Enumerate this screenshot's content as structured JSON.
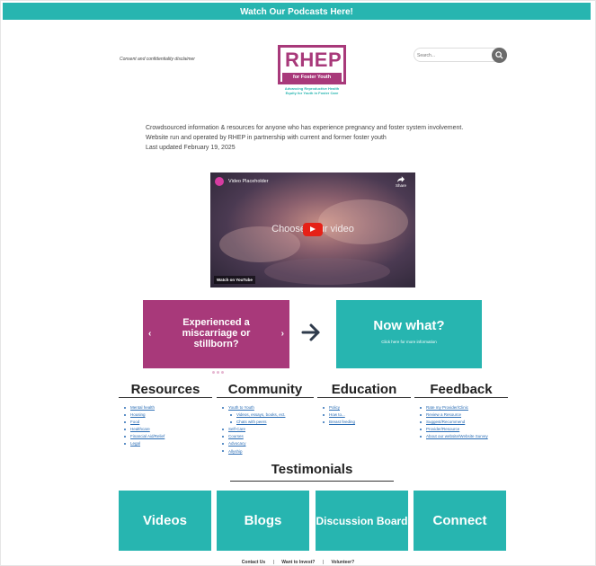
{
  "top_banner": {
    "label": "Watch Our Podcasts Here!",
    "color": "#27b5b0"
  },
  "header": {
    "disclaimer": "Consent and confidentiality disclaimer",
    "logo": {
      "word": "RHEP",
      "subtitle": "for Foster Youth",
      "tagline_1": "Advancing Reproductive Health",
      "tagline_2": "Equity for Youth in Foster Care",
      "color": "#a8397a"
    },
    "search": {
      "placeholder": "Search..."
    }
  },
  "intro": {
    "line_1": "Crowdsourced information & resources for anyone who has experience pregnancy and foster system involvement.",
    "line_2": "Website run and operated by RHEP in partnership with current and former foster youth",
    "line_3": "Last updated February 19, 2025"
  },
  "video": {
    "title": "Video Placeholder",
    "center_text": "Choose your video",
    "share_label": "Share",
    "watch_on": "Watch on",
    "youtube_label": "YouTube"
  },
  "carousel": {
    "slide_text": "Experienced a miscarriage or stillborn?",
    "color": "#a8397a",
    "slide_count": 4,
    "active_index": 0
  },
  "now_what": {
    "title": "Now what?",
    "subtitle": "Click here for more information",
    "color": "#27b5b0"
  },
  "sections": {
    "resources": {
      "title": "Resources",
      "items": [
        "Mental health",
        "Housing",
        "Food",
        "Healthcare",
        "Financial Aid/Relief",
        "Legal"
      ]
    },
    "community": {
      "title": "Community",
      "items": [
        {
          "label": "Youth to Youth",
          "sub": false
        },
        {
          "label": "Videos, essays, books, ect.",
          "sub": true
        },
        {
          "label": "Chats with peers",
          "sub": true
        },
        {
          "label": "Self-Care",
          "sub": false
        },
        {
          "label": "Courses",
          "sub": false
        },
        {
          "label": "Advocacy",
          "sub": false
        },
        {
          "label": "Allyship",
          "sub": false
        }
      ]
    },
    "education": {
      "title": "Education",
      "items": [
        "Policy",
        "How to...",
        "Breast feeding"
      ]
    },
    "feedback": {
      "title": "Feedback",
      "items": [
        "Rate my Provider/Clinic",
        "Review a Resource",
        "Suggest/Recommend",
        "Provider/Resource",
        "About our website/Website Survey"
      ]
    }
  },
  "testimonials": {
    "title": "Testimonials",
    "tiles": [
      "Videos",
      "Blogs",
      "Discussion Board",
      "Connect"
    ]
  },
  "footer": {
    "links": [
      "Contact Us",
      "Want to Invest?",
      "Volunteer?"
    ],
    "separator": "|"
  }
}
